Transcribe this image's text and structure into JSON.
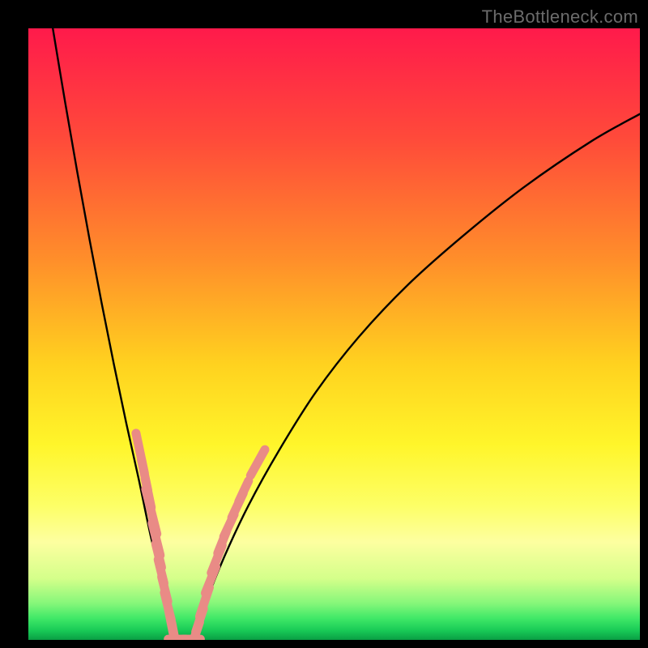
{
  "watermark": {
    "text": "TheBottleneck.com"
  },
  "chart_data": {
    "type": "line",
    "title": "",
    "xlabel": "",
    "ylabel": "",
    "xlim": [
      0,
      100
    ],
    "ylim": [
      0,
      100
    ],
    "grid": false,
    "legend": false,
    "background_gradient": {
      "stops": [
        {
          "offset": 0.0,
          "color": "#ff1a4b"
        },
        {
          "offset": 0.18,
          "color": "#ff4a3a"
        },
        {
          "offset": 0.38,
          "color": "#ff8f2a"
        },
        {
          "offset": 0.55,
          "color": "#ffd21f"
        },
        {
          "offset": 0.68,
          "color": "#fff52a"
        },
        {
          "offset": 0.78,
          "color": "#fdff66"
        },
        {
          "offset": 0.84,
          "color": "#fdffa0"
        },
        {
          "offset": 0.9,
          "color": "#d4ff8a"
        },
        {
          "offset": 0.94,
          "color": "#86f77a"
        },
        {
          "offset": 0.965,
          "color": "#3fe867"
        },
        {
          "offset": 0.985,
          "color": "#18c956"
        },
        {
          "offset": 1.0,
          "color": "#0a9e44"
        }
      ]
    },
    "series": [
      {
        "name": "left-branch",
        "x": [
          4,
          6,
          8,
          10,
          12,
          14,
          16,
          18,
          20,
          21.5,
          23,
          24
        ],
        "y": [
          100,
          88,
          76.5,
          65.5,
          55,
          45,
          35.5,
          26.5,
          17,
          11,
          5,
          0
        ]
      },
      {
        "name": "right-branch",
        "x": [
          27,
          29,
          32,
          36,
          41,
          47,
          54,
          62,
          71,
          81,
          92,
          100
        ],
        "y": [
          0,
          6,
          13.5,
          22,
          31,
          40.5,
          49.5,
          58,
          66,
          74,
          81.5,
          86
        ]
      }
    ],
    "scatter_overlay": {
      "name": "pink-capsules",
      "color": "#e98b86",
      "points_left": [
        {
          "x": 18.3,
          "y": 30.5,
          "len": 3.2
        },
        {
          "x": 19.0,
          "y": 27.0,
          "len": 2.5
        },
        {
          "x": 19.6,
          "y": 24.0,
          "len": 2.3
        },
        {
          "x": 20.1,
          "y": 21.0,
          "len": 3.6
        },
        {
          "x": 20.9,
          "y": 16.5,
          "len": 2.6
        },
        {
          "x": 21.3,
          "y": 13.8,
          "len": 1.9
        },
        {
          "x": 21.7,
          "y": 11.2,
          "len": 1.9
        },
        {
          "x": 22.3,
          "y": 8.3,
          "len": 2.0
        },
        {
          "x": 22.8,
          "y": 5.5,
          "len": 2.2
        },
        {
          "x": 23.3,
          "y": 3.0,
          "len": 1.9
        },
        {
          "x": 23.8,
          "y": 1.0,
          "len": 1.7
        }
      ],
      "points_right": [
        {
          "x": 27.4,
          "y": 1.1,
          "len": 1.8
        },
        {
          "x": 28.0,
          "y": 3.2,
          "len": 1.9
        },
        {
          "x": 28.8,
          "y": 6.2,
          "len": 2.4
        },
        {
          "x": 29.8,
          "y": 9.8,
          "len": 2.2
        },
        {
          "x": 30.8,
          "y": 13.2,
          "len": 2.3
        },
        {
          "x": 31.7,
          "y": 16.0,
          "len": 1.9
        },
        {
          "x": 32.8,
          "y": 18.7,
          "len": 1.9
        },
        {
          "x": 34.2,
          "y": 22.0,
          "len": 2.1
        },
        {
          "x": 35.2,
          "y": 24.3,
          "len": 1.8
        },
        {
          "x": 37.5,
          "y": 29.0,
          "len": 2.3
        }
      ],
      "points_bottom": [
        {
          "x": 24.3,
          "y": 0.15,
          "len": 1.4
        },
        {
          "x": 25.1,
          "y": 0.1,
          "len": 1.3
        },
        {
          "x": 25.9,
          "y": 0.1,
          "len": 1.3
        },
        {
          "x": 26.7,
          "y": 0.15,
          "len": 1.4
        }
      ]
    }
  }
}
